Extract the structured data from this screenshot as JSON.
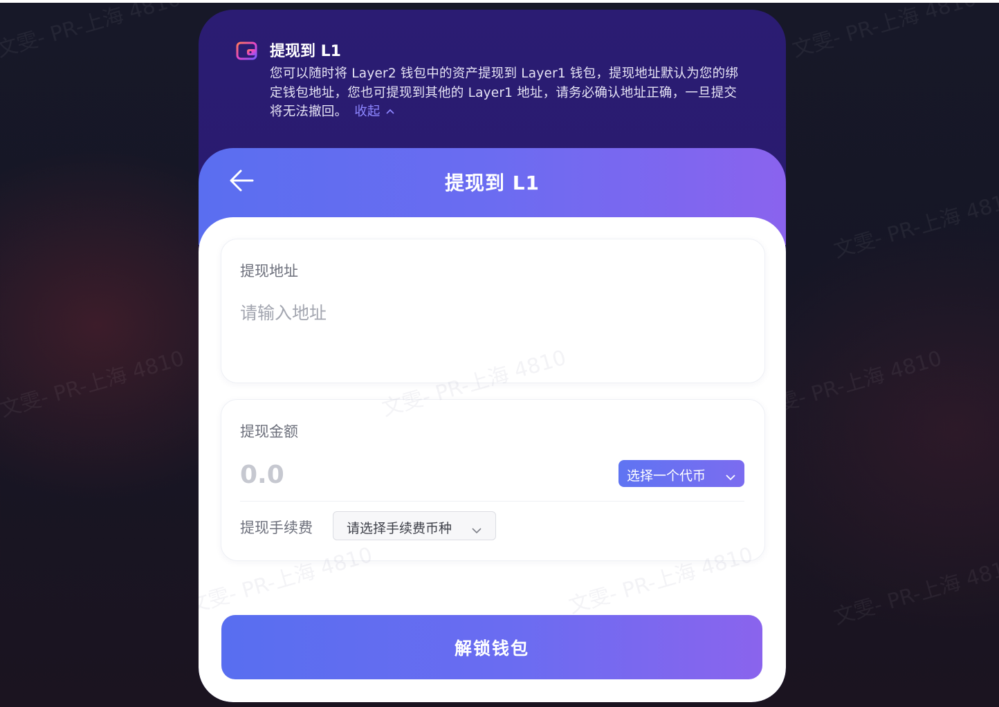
{
  "notice": {
    "icon": "wallet-icon",
    "title": "提现到 L1",
    "text": "您可以随时将 Layer2 钱包中的资产提现到 Layer1 钱包，提现地址默认为您的绑定钱包地址，您也可提现到其他的 Layer1 地址，请务必确认地址正确，一旦提交将无法撤回。",
    "collapse_label": "收起",
    "collapse_icon": "chevron-up-icon"
  },
  "header": {
    "back_icon": "arrow-left-icon",
    "title": "提现到 L1"
  },
  "address_card": {
    "label": "提现地址",
    "placeholder": "请输入地址"
  },
  "amount_card": {
    "label": "提现金额",
    "placeholder": "0.0",
    "token_select_label": "选择一个代币",
    "fee_label": "提现手续费",
    "fee_select_label": "请选择手续费币种"
  },
  "unlock_button": "解锁钱包",
  "watermark": "文雯- PR-上海 4810",
  "colors": {
    "accent_start": "#586EF0",
    "accent_end": "#8A64ED",
    "panel_dark": "#281A6E",
    "link": "#8D86FF"
  }
}
